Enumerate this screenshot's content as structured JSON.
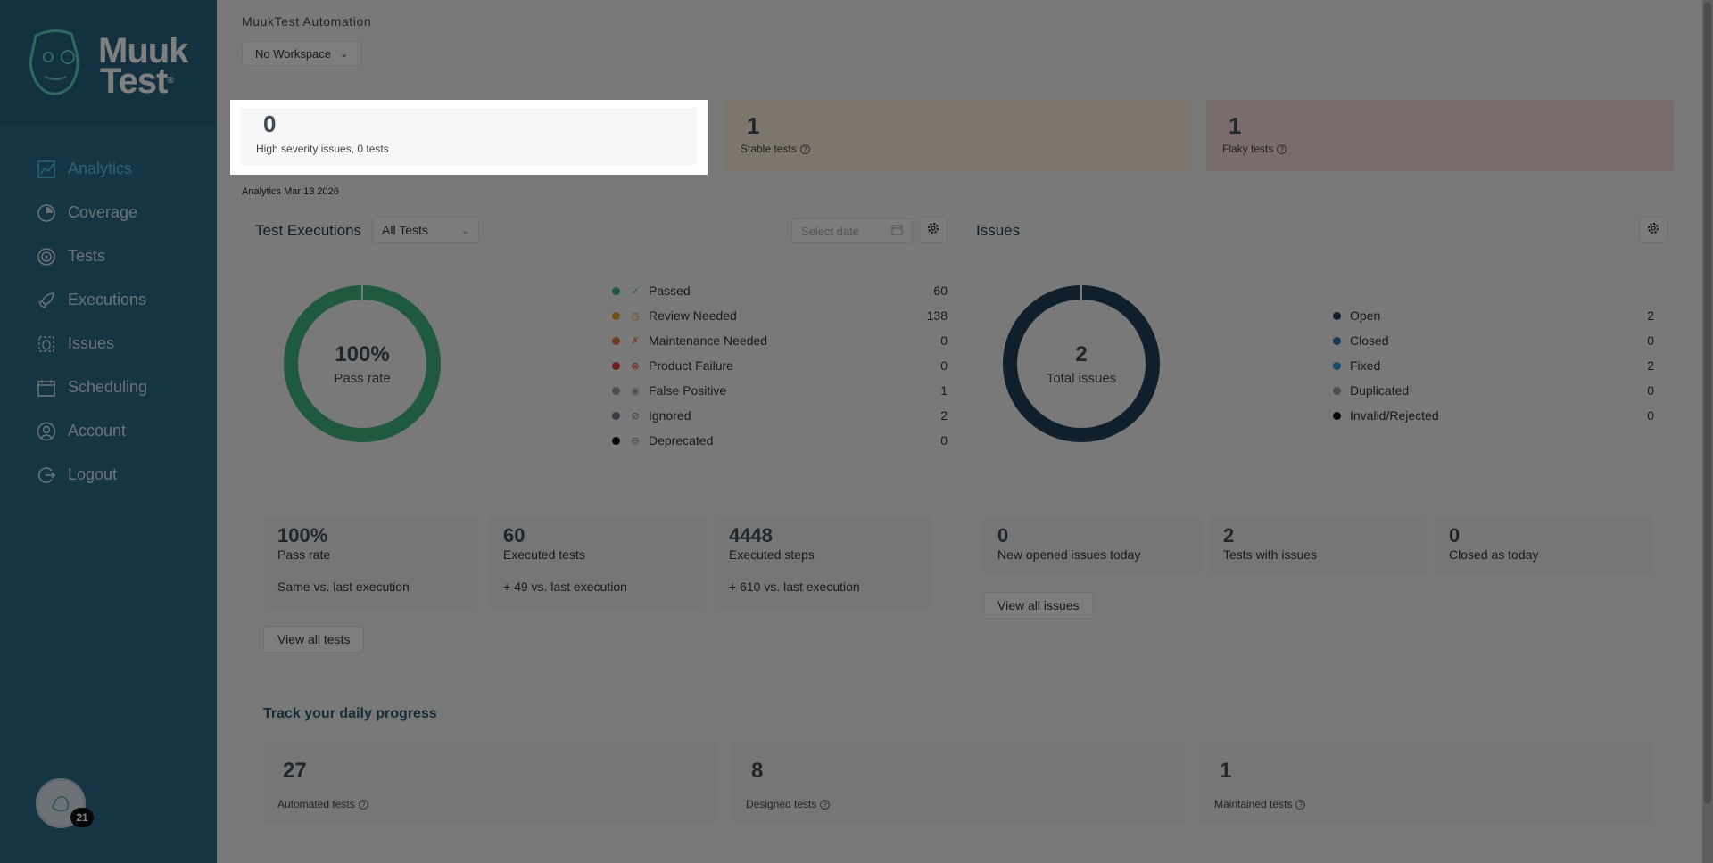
{
  "logo": {
    "line1": "Muuk",
    "line2": "Test",
    "mark": "®"
  },
  "nav": [
    {
      "label": "Analytics",
      "icon": "chart-icon",
      "active": true
    },
    {
      "label": "Coverage",
      "icon": "pie-icon"
    },
    {
      "label": "Tests",
      "icon": "target-icon"
    },
    {
      "label": "Executions",
      "icon": "rocket-icon"
    },
    {
      "label": "Issues",
      "icon": "bug-icon"
    },
    {
      "label": "Scheduling",
      "icon": "calendar-icon"
    },
    {
      "label": "Account",
      "icon": "user-icon"
    },
    {
      "label": "Logout",
      "icon": "logout-icon"
    }
  ],
  "avatar": {
    "badge": "21"
  },
  "header": {
    "title": "MuukTest Automation",
    "workspace": "No Workspace"
  },
  "summary": {
    "high": {
      "value": "0",
      "caption": "High severity issues, 0 tests"
    },
    "stable": {
      "value": "1",
      "caption": "Stable tests"
    },
    "flaky": {
      "value": "1",
      "caption": "Flaky tests"
    }
  },
  "analytics_date": "Analytics Mar 13 2026",
  "executions": {
    "title": "Test Executions",
    "filter": "All Tests",
    "date_placeholder": "Select date",
    "donut": {
      "value": "100%",
      "label": "Pass rate",
      "fraction": 1.0
    },
    "legend": [
      {
        "label": "Passed",
        "value": "60",
        "color": "#3fb57f"
      },
      {
        "label": "Review Needed",
        "value": "138",
        "color": "#e3a12a"
      },
      {
        "label": "Maintenance Needed",
        "value": "0",
        "color": "#e07b47"
      },
      {
        "label": "Product Failure",
        "value": "0",
        "color": "#d9383a"
      },
      {
        "label": "False Positive",
        "value": "1",
        "color": "#9a9a9a"
      },
      {
        "label": "Ignored",
        "value": "2",
        "color": "#6e7a86"
      },
      {
        "label": "Deprecated",
        "value": "0",
        "color": "#111111"
      }
    ],
    "stats": [
      {
        "value": "100%",
        "label": "Pass rate",
        "compare": "Same vs. last execution"
      },
      {
        "value": "60",
        "label": "Executed tests",
        "compare": "+ 49 vs. last execution"
      },
      {
        "value": "4448",
        "label": "Executed steps",
        "compare": "+ 610 vs. last execution"
      }
    ],
    "view_all": "View all tests"
  },
  "issues": {
    "title": "Issues",
    "donut": {
      "value": "2",
      "label": "Total issues",
      "fraction": 1.0
    },
    "legend": [
      {
        "label": "Open",
        "value": "2",
        "color": "#1f3f58"
      },
      {
        "label": "Closed",
        "value": "0",
        "color": "#2e6fa8"
      },
      {
        "label": "Fixed",
        "value": "2",
        "color": "#2a9bd0"
      },
      {
        "label": "Duplicated",
        "value": "0",
        "color": "#9a9a9a"
      },
      {
        "label": "Invalid/Rejected",
        "value": "0",
        "color": "#111111"
      }
    ],
    "stats": [
      {
        "value": "0",
        "label": "New opened issues today"
      },
      {
        "value": "2",
        "label": "Tests with issues"
      },
      {
        "value": "0",
        "label": "Closed as today"
      }
    ],
    "view_all": "View all issues"
  },
  "progress": {
    "title": "Track your daily progress",
    "cards": [
      {
        "value": "27",
        "caption": "Automated tests"
      },
      {
        "value": "8",
        "caption": "Designed tests"
      },
      {
        "value": "1",
        "caption": "Maintained tests"
      }
    ]
  }
}
